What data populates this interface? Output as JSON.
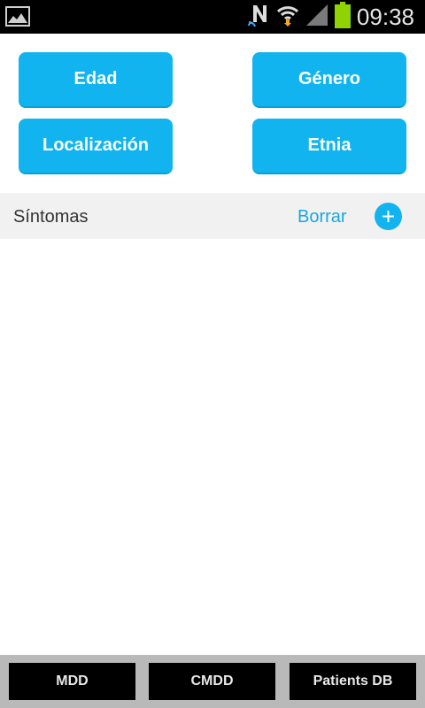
{
  "status_bar": {
    "time": "09:38",
    "icons": [
      "gallery-icon",
      "nfc-icon",
      "wifi-icon",
      "signal-icon",
      "battery-icon"
    ]
  },
  "filters": {
    "age_label": "Edad",
    "gender_label": "Género",
    "location_label": "Localización",
    "ethnicity_label": "Etnia"
  },
  "symptoms": {
    "title": "Síntomas",
    "clear_label": "Borrar",
    "add_icon": "plus-icon",
    "items": []
  },
  "bottom_nav": {
    "items": [
      {
        "label": "MDD"
      },
      {
        "label": "CMDD"
      },
      {
        "label": "Patients DB"
      }
    ]
  },
  "colors": {
    "accent": "#11b4ee",
    "link": "#1aa6e0",
    "battery": "#8fd400",
    "nav_background": "#b9b9b9"
  }
}
